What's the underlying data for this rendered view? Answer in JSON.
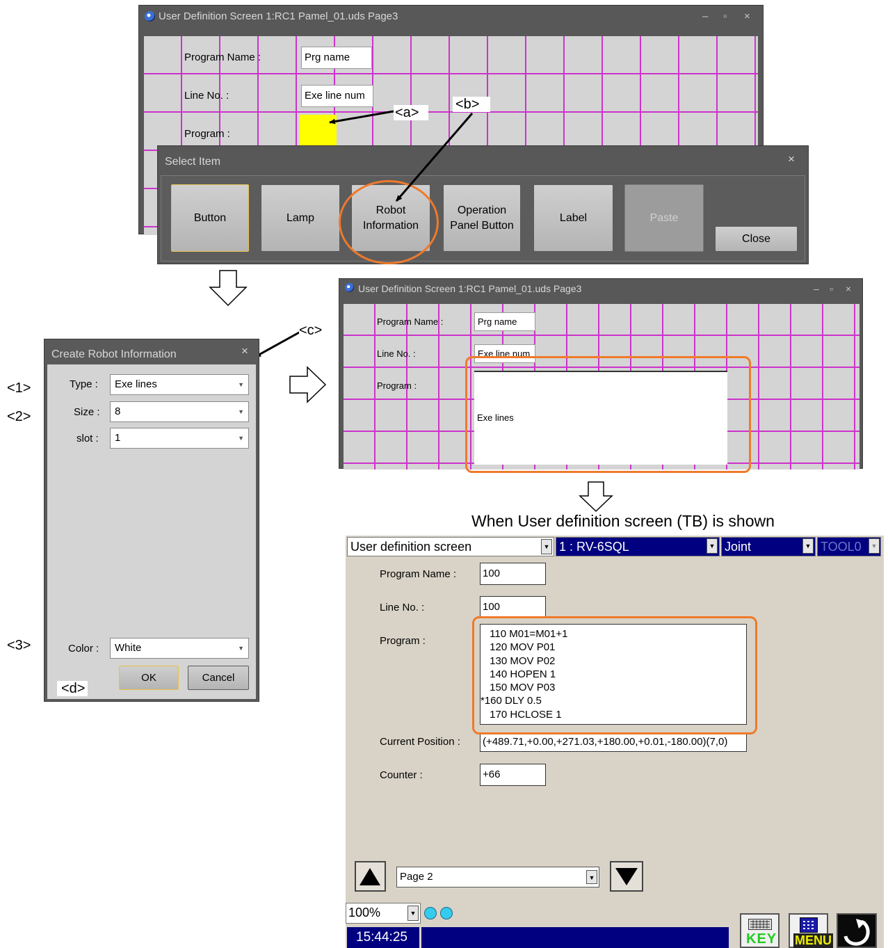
{
  "editor_top": {
    "title": "User Definition Screen 1:RC1 Pamel_01.uds Page3",
    "controls": [
      "–",
      "▫",
      "×"
    ],
    "program_name_label": "Program Name :",
    "program_name_value": "Prg name",
    "line_no_label": "Line No. :",
    "line_no_value": "Exe line num",
    "program_label": "Program :"
  },
  "select_item": {
    "title": "Select Item",
    "close_glyph": "×",
    "buttons": [
      "Button",
      "Lamp",
      "Robot Information",
      "Operation Panel Button",
      "Label",
      "Paste"
    ],
    "close_label": "Close"
  },
  "create_robot_info": {
    "title": "Create Robot Information",
    "close_glyph": "×",
    "type_label": "Type :",
    "type_value": "Exe lines",
    "size_label": "Size :",
    "size_value": "8",
    "slot_label": "slot :",
    "slot_value": "1",
    "color_label": "Color :",
    "color_value": "White",
    "ok_label": "OK",
    "cancel_label": "Cancel"
  },
  "editor_result": {
    "title": "User Definition Screen 1:RC1 Pamel_01.uds Page3",
    "program_name_label": "Program Name :",
    "program_name_value": "Prg name",
    "line_no_label": "Line No. :",
    "line_no_value": "Exe line num",
    "program_label": "Program :",
    "exe_lines_label": "Exe lines"
  },
  "annotations": {
    "a": "<a>",
    "b": "<b>",
    "c": "<c>",
    "d": "<d>",
    "one": "<1>",
    "two": "<2>",
    "three": "<3>"
  },
  "caption": "When User definition screen (TB) is shown",
  "tb_screen": {
    "screen_select": "User definition screen",
    "robot_select": "1 : RV-6SQL",
    "jog_mode": "Joint",
    "tool": "TOOL0",
    "program_name_label": "Program Name :",
    "program_name_value": "100",
    "line_no_label": "Line No. :",
    "line_no_value": "100",
    "program_label": "Program :",
    "program_lines": [
      " 110 M01=M01+1",
      " 120 MOV P01",
      " 130 MOV P02",
      " 140 HOPEN 1",
      " 150 MOV P03",
      "*160 DLY 0.5",
      " 170 HCLOSE 1"
    ],
    "current_position_label": "Current Position :",
    "current_position_value": "(+489.71,+0.00,+271.03,+180.00,+0.01,-180.00)(7,0)",
    "counter_label": "Counter :",
    "counter_value": "+66",
    "page_select": "Page 2",
    "zoom": "100%",
    "time": "15:44:25",
    "key_label": "KEY",
    "menu_label": "MENU"
  },
  "colors": {
    "grid_line": "#cc33cc",
    "highlight": "#ef7a2a",
    "yellow_slot": "#ffff00",
    "tb_blue": "#000080"
  }
}
